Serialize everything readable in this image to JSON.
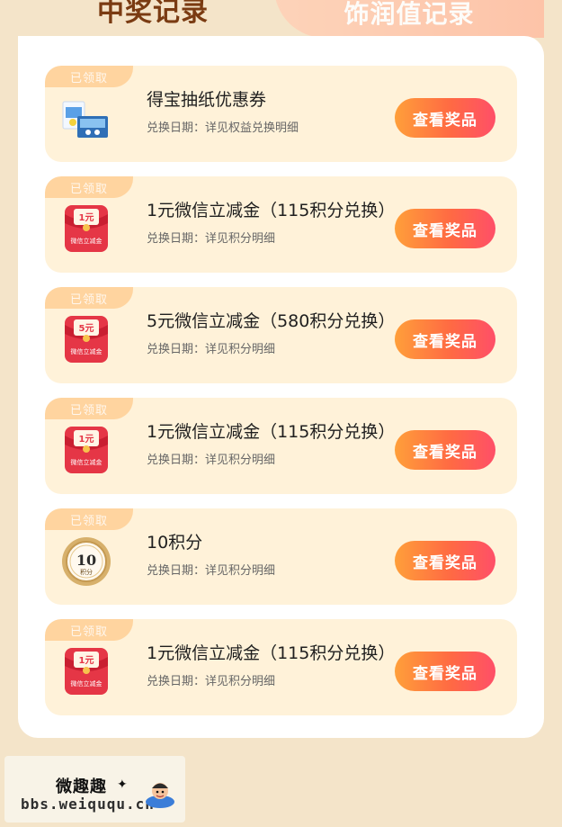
{
  "tabs": {
    "left": "中奖记录",
    "right": "饰润值记录"
  },
  "records": [
    {
      "badge": "已领取",
      "title": "得宝抽纸优惠券",
      "subtitle": "兑换日期：详见权益兑换明细",
      "button": "查看奖品",
      "icon": "tissue-box-icon"
    },
    {
      "badge": "已领取",
      "title": "1元微信立减金（115积分兑换）",
      "subtitle": "兑换日期：详见积分明细",
      "button": "查看奖品",
      "icon": "red-envelope-icon",
      "amount": "1元",
      "envelope_label": "微信立减金"
    },
    {
      "badge": "已领取",
      "title": "5元微信立减金（580积分兑换）",
      "subtitle": "兑换日期：详见积分明细",
      "button": "查看奖品",
      "icon": "red-envelope-icon",
      "amount": "5元",
      "envelope_label": "微信立减金"
    },
    {
      "badge": "已领取",
      "title": "1元微信立减金（115积分兑换）",
      "subtitle": "兑换日期：详见积分明细",
      "button": "查看奖品",
      "icon": "red-envelope-icon",
      "amount": "1元",
      "envelope_label": "微信立减金"
    },
    {
      "badge": "已领取",
      "title": "10积分",
      "subtitle": "兑换日期：详见积分明细",
      "button": "查看奖品",
      "icon": "points-coin-icon",
      "coin_value": "10",
      "coin_label": "积分"
    },
    {
      "badge": "已领取",
      "title": "1元微信立减金（115积分兑换）",
      "subtitle": "兑换日期：详见积分明细",
      "button": "查看奖品",
      "icon": "red-envelope-icon",
      "amount": "1元",
      "envelope_label": "微信立减金"
    }
  ],
  "watermark": {
    "cn": "微趣趣",
    "en": "bbs.weiququ.cn"
  },
  "colors": {
    "background": "#f4e4c9",
    "card": "#fff2d9",
    "badge": "#ffd49f",
    "button_start": "#ff9f3a",
    "button_end": "#ff4f68"
  }
}
